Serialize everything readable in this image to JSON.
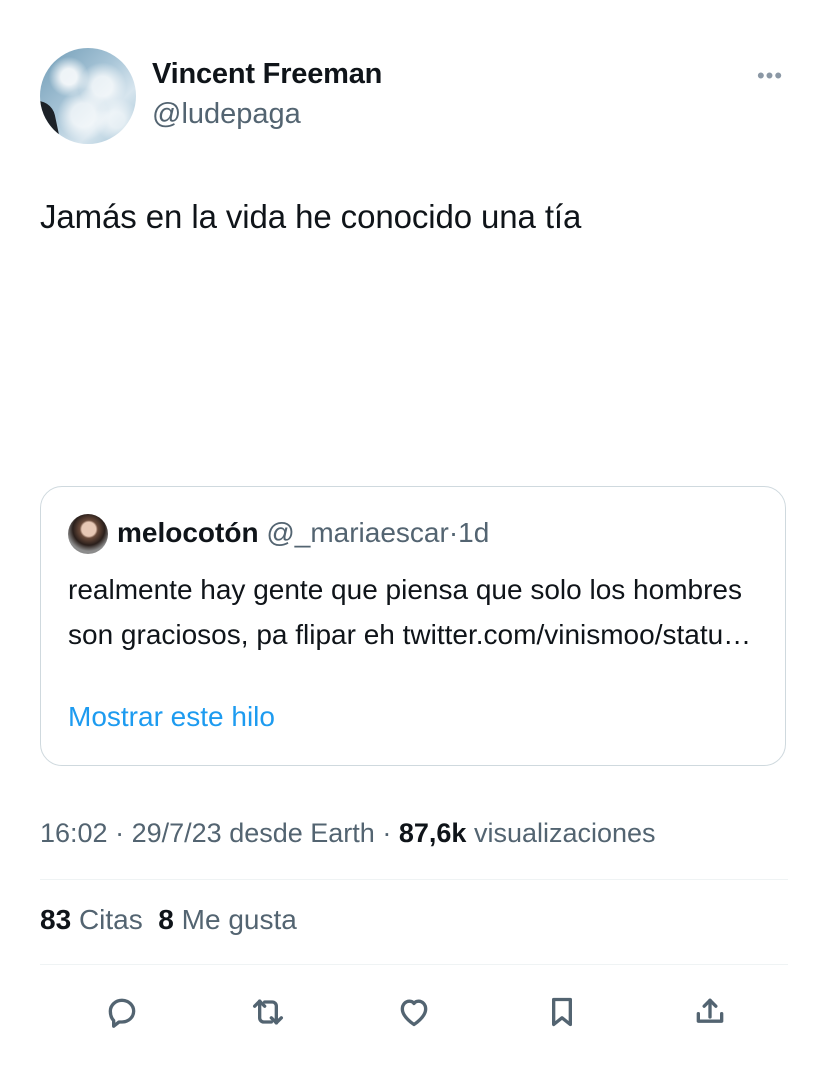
{
  "author": {
    "name": "Vincent Freeman",
    "handle": "@ludepaga"
  },
  "tweet": {
    "text": "Jamás en la vida he conocido una tía"
  },
  "quote": {
    "name": "melocotón",
    "handle": "@_mariaescar",
    "separator": "·",
    "time": "1d",
    "text": "realmente hay gente que piensa que solo los hombres son graciosos, pa flipar eh twitter.com/vinismoo/statu…",
    "show_thread_label": "Mostrar este hilo"
  },
  "meta": {
    "time": "16:02",
    "separator": "·",
    "date": "29/7/23",
    "source": "desde Earth",
    "views_count": "87,6k",
    "views_label": "visualizaciones"
  },
  "stats": {
    "quotes_count": "83",
    "quotes_label": "Citas",
    "likes_count": "8",
    "likes_label": "Me gusta"
  },
  "icons": {
    "more": "more-icon",
    "reply": "reply-icon",
    "retweet": "retweet-icon",
    "like": "heart-icon",
    "bookmark": "bookmark-icon",
    "share": "share-icon"
  },
  "colors": {
    "link": "#1d9bf0",
    "secondary_text": "#536471",
    "border": "#cfd9de"
  }
}
